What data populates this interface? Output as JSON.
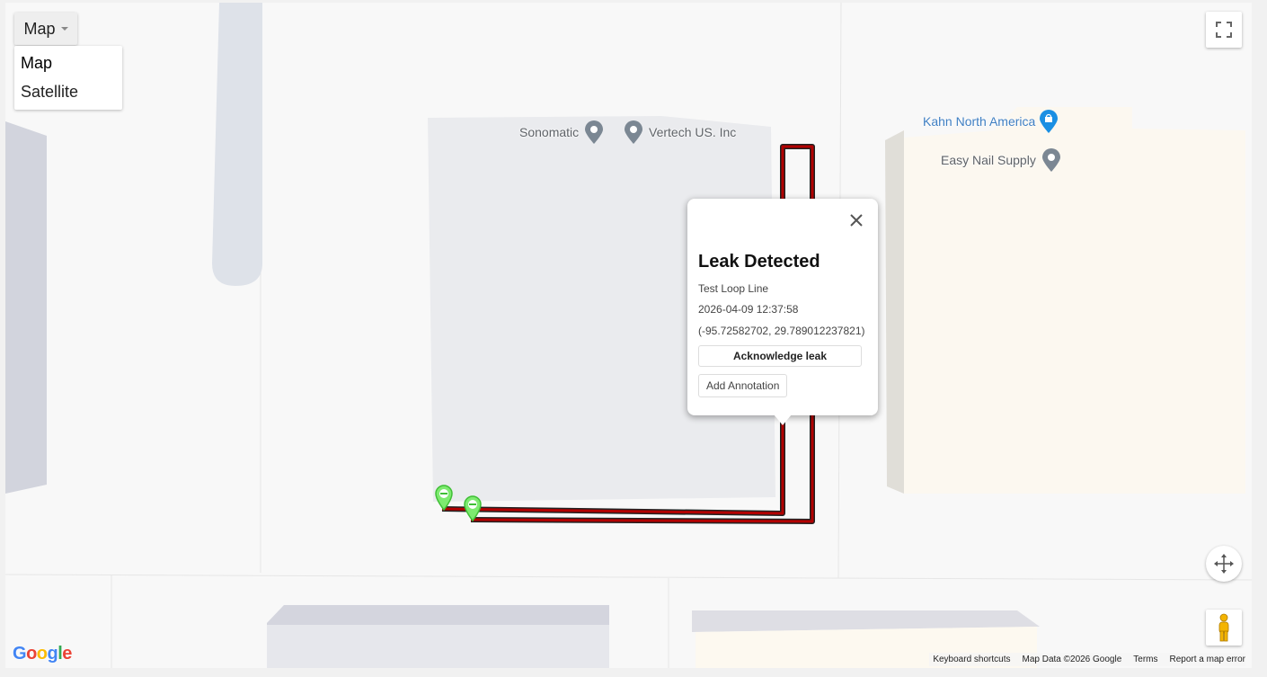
{
  "map_type_control": {
    "current": "Map",
    "options": [
      "Map",
      "Satellite"
    ]
  },
  "pois": {
    "sonomatic": "Sonomatic",
    "vertech": "Vertech US. Inc",
    "kahn": "Kahn North America",
    "easy_nail": "Easy Nail Supply"
  },
  "info_window": {
    "title": "Leak Detected",
    "line_name": "Test Loop Line",
    "timestamp": "2026-04-09 12:37:58",
    "coordinates": "(-95.72582702, 29.789012237821)",
    "acknowledge_label": "Acknowledge leak",
    "annotation_label": "Add Annotation"
  },
  "footer": {
    "keyboard": "Keyboard shortcuts",
    "map_data": "Map Data ©2026 Google",
    "terms": "Terms",
    "report": "Report a map error"
  },
  "logo": "Google",
  "colors": {
    "pipeline": "#b30000",
    "marker_green": "#33cc33",
    "poi_grey": "#7b8793",
    "poi_blue": "#1a8fe3"
  },
  "icons": {
    "fullscreen": "fullscreen-icon",
    "close": "close-icon",
    "camera": "camera-control-icon",
    "pegman": "pegman-icon"
  }
}
